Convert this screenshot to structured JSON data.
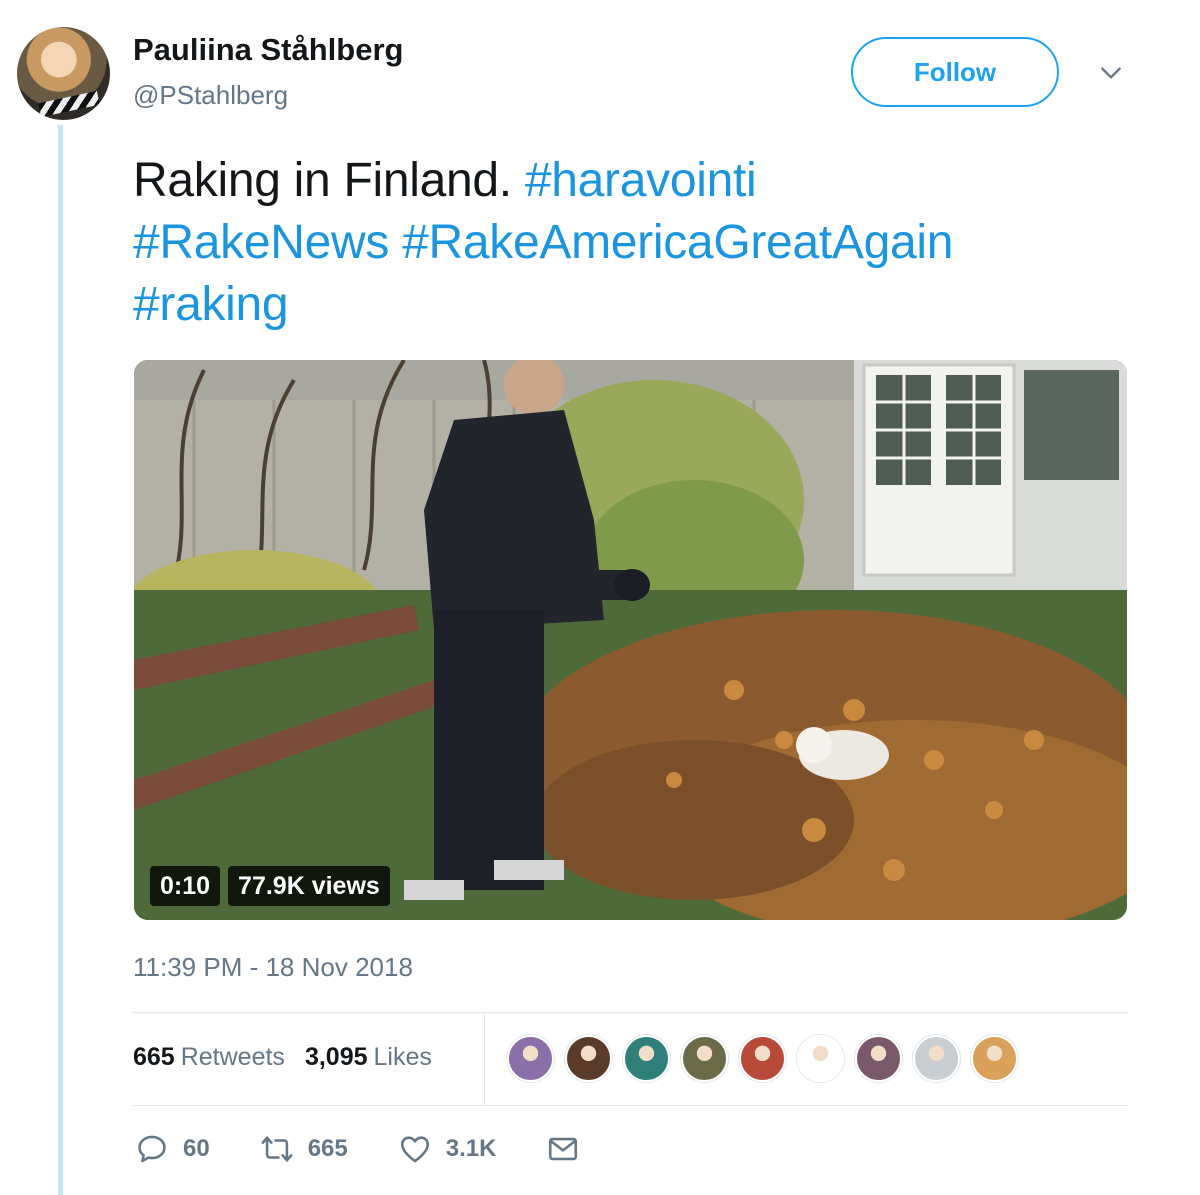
{
  "author": {
    "name": "Pauliina Ståhlberg",
    "handle": "@PStahlberg"
  },
  "follow_label": "Follow",
  "tweet": {
    "text_plain": "Raking in Finland.",
    "hashtags": [
      "#haravointi",
      "#RakeNews",
      "#RakeAmericaGreatAgain",
      "#raking"
    ]
  },
  "video": {
    "duration": "0:10",
    "views": "77.9K views"
  },
  "timestamp": "11:39 PM - 18 Nov 2018",
  "stats": {
    "retweets_count": "665",
    "retweets_label": "Retweets",
    "likes_count": "3,095",
    "likes_label": "Likes"
  },
  "likers": [
    {
      "color": "#8a6fa8"
    },
    {
      "color": "#5a3b2a"
    },
    {
      "color": "#2f7f7a"
    },
    {
      "color": "#6b6b4a"
    },
    {
      "color": "#b84a3a"
    },
    {
      "color": "#ffffff"
    },
    {
      "color": "#7a5a6a"
    },
    {
      "color": "#c9ced3"
    },
    {
      "color": "#d9a15a"
    }
  ],
  "actions": {
    "replies": "60",
    "retweets": "665",
    "likes": "3.1K"
  },
  "colors": {
    "brand": "#1da1f2",
    "hashtag": "#1b95e0",
    "secondary_text": "#657786"
  }
}
